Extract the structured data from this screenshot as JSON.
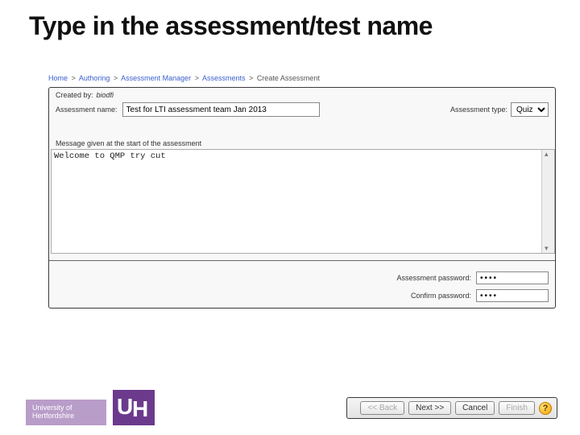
{
  "slide": {
    "title": "Type in the assessment/test name"
  },
  "breadcrumb": {
    "items": [
      "Home",
      "Authoring",
      "Assessment Manager",
      "Assessments",
      "Create Assessment"
    ],
    "sep": ">"
  },
  "form": {
    "created_by_label": "Created by:",
    "created_by_value": "biodfi",
    "name_label": "Assessment name:",
    "name_value": "Test for LTI assessment team Jan 2013",
    "type_label": "Assessment type:",
    "type_value": "Quiz",
    "message_label": "Message given at the start of the assessment",
    "message_value": "Welcome to QMP try cut",
    "password_label": "Assessment password:",
    "password_value": "••••",
    "confirm_label": "Confirm password:",
    "confirm_value": "••••"
  },
  "buttons": {
    "back": "<< Back",
    "next": "Next >>",
    "cancel": "Cancel",
    "finish": "Finish"
  },
  "branding": {
    "line1": "University of",
    "line2": "Hertfordshire"
  }
}
